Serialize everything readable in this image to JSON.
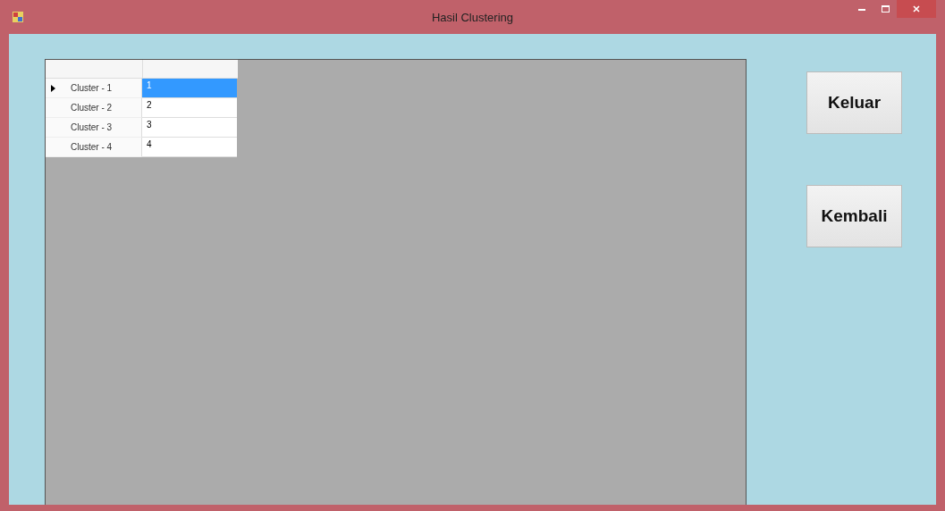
{
  "window": {
    "title": "Hasil Clustering"
  },
  "grid": {
    "rows": [
      {
        "header": "Cluster - 1",
        "value": "1",
        "selected": true
      },
      {
        "header": "Cluster - 2",
        "value": "2",
        "selected": false
      },
      {
        "header": "Cluster - 3",
        "value": "3",
        "selected": false
      },
      {
        "header": "Cluster - 4",
        "value": "4",
        "selected": false
      }
    ]
  },
  "buttons": [
    "Keluar",
    "Kembali"
  ]
}
